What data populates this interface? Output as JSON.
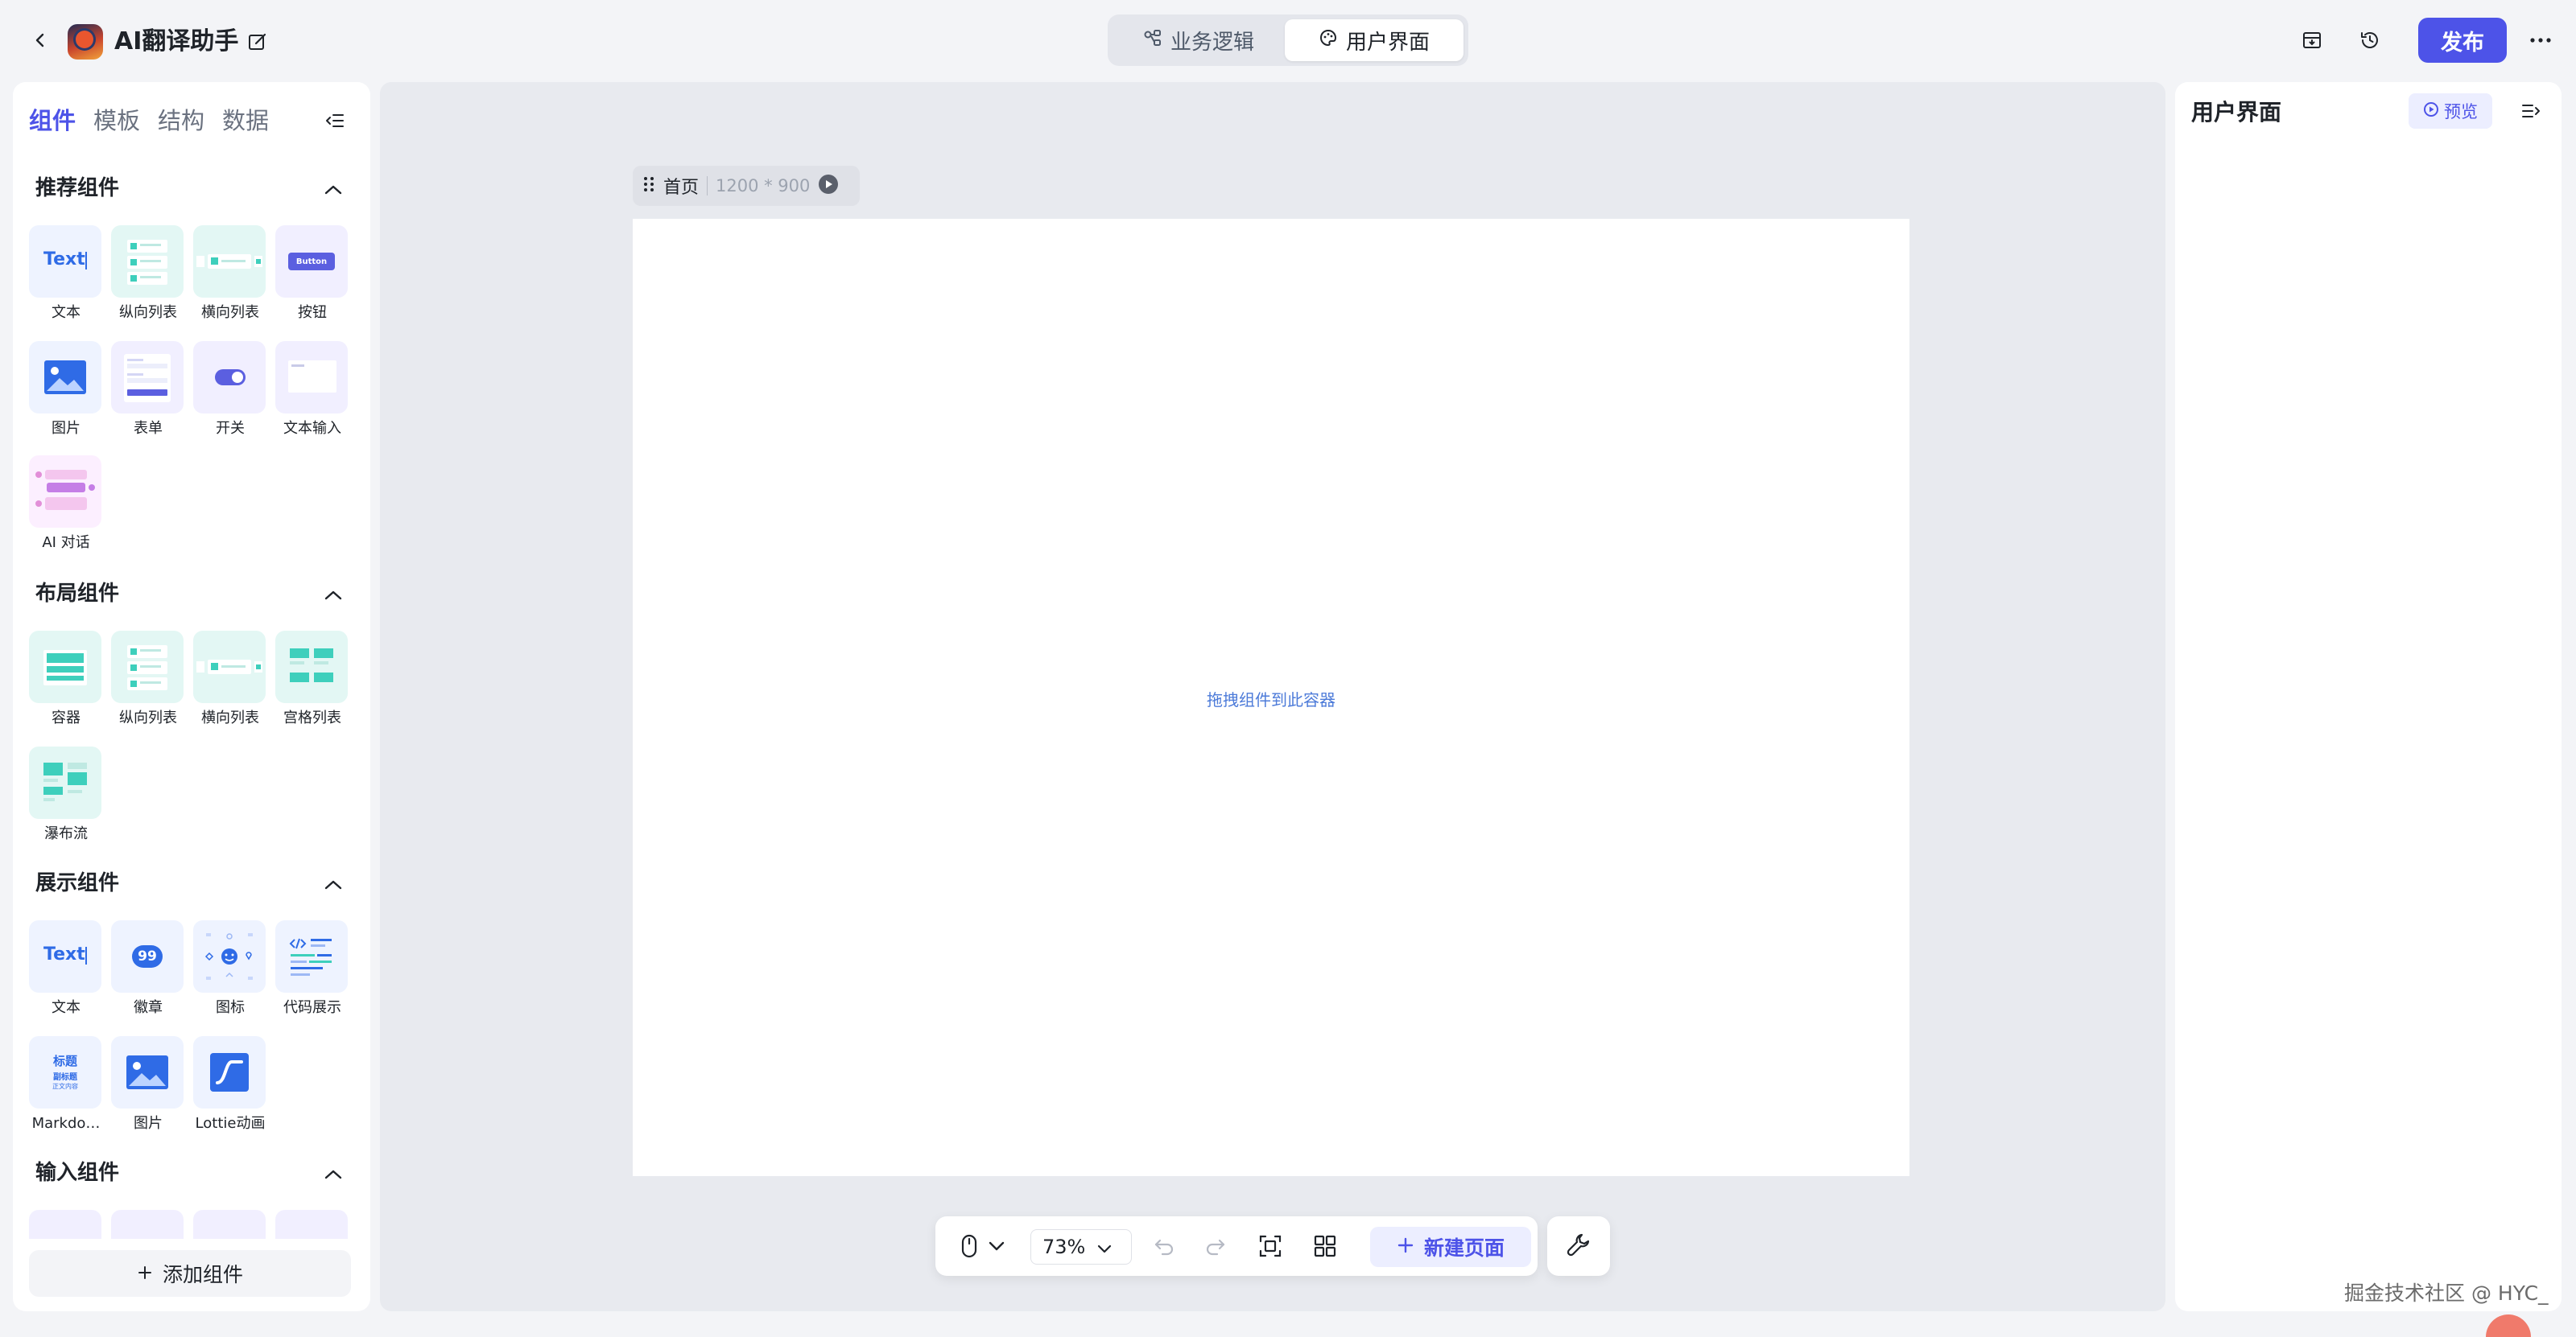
{
  "header": {
    "app_title": "AI翻译助手",
    "tabs": [
      {
        "label": "业务逻辑",
        "icon": "flow-icon",
        "active": false
      },
      {
        "label": "用户界面",
        "icon": "palette-icon",
        "active": true
      }
    ],
    "publish_label": "发布"
  },
  "left_panel": {
    "tabs": [
      "组件",
      "模板",
      "结构",
      "数据"
    ],
    "active_tab": "组件",
    "sections": [
      {
        "title": "推荐组件",
        "items": [
          "文本",
          "纵向列表",
          "横向列表",
          "按钮",
          "图片",
          "表单",
          "开关",
          "文本输入",
          "AI 对话"
        ]
      },
      {
        "title": "布局组件",
        "items": [
          "容器",
          "纵向列表",
          "横向列表",
          "宫格列表",
          "瀑布流"
        ]
      },
      {
        "title": "展示组件",
        "items": [
          "文本",
          "徽章",
          "图标",
          "代码展示",
          "Markdo…",
          "图片",
          "Lottie动画"
        ]
      },
      {
        "title": "输入组件",
        "items": []
      }
    ],
    "tile_text": {
      "text_sample": "Text",
      "button_sample": "Button",
      "badge_number": "99",
      "md_heading": "标题",
      "md_sub": "副标题",
      "md_body": "正文内容"
    },
    "add_component_label": "添加组件"
  },
  "canvas": {
    "page_name": "首页",
    "page_size": "1200 * 900",
    "drop_hint": "拖拽组件到此容器",
    "zoom": "73%",
    "new_page_label": "新建页面"
  },
  "right_panel": {
    "title": "用户界面",
    "preview_label": "预览"
  },
  "watermark": "掘金技术社区 @ HYC_",
  "colors": {
    "accent": "#4d53e8",
    "teal": "#3ecfbc",
    "blue": "#2f6be6"
  }
}
